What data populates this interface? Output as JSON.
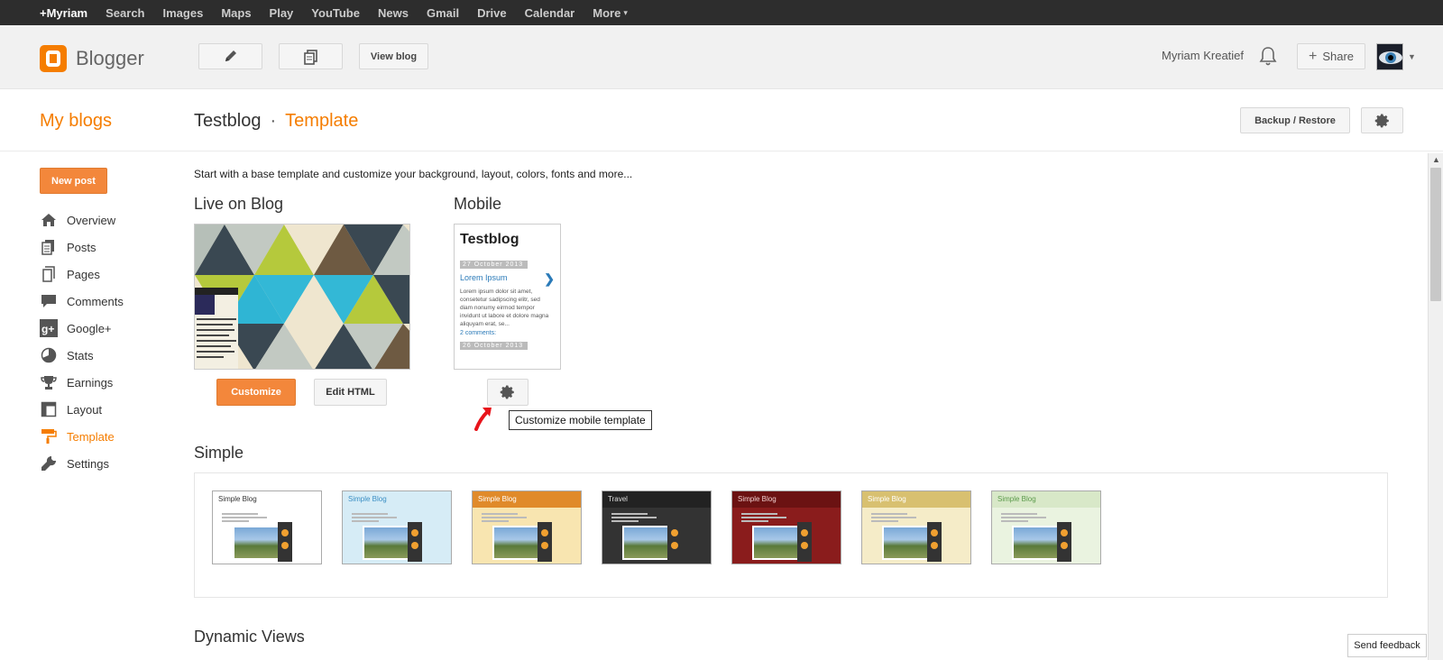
{
  "gbar": {
    "items": [
      "+Myriam",
      "Search",
      "Images",
      "Maps",
      "Play",
      "YouTube",
      "News",
      "Gmail",
      "Drive",
      "Calendar",
      "More"
    ]
  },
  "header": {
    "logo_text": "Blogger",
    "view_blog": "View blog",
    "user_name": "Myriam Kreatief",
    "share": "Share",
    "accent": "#f57d00"
  },
  "titlebar": {
    "my_blogs": "My blogs",
    "blog_name": "Testblog",
    "separator": "·",
    "page": "Template",
    "backup_restore": "Backup / Restore"
  },
  "sidebar": {
    "new_post": "New post",
    "items": [
      {
        "label": "Overview",
        "icon": "home-icon"
      },
      {
        "label": "Posts",
        "icon": "posts-icon"
      },
      {
        "label": "Pages",
        "icon": "pages-icon"
      },
      {
        "label": "Comments",
        "icon": "comment-icon"
      },
      {
        "label": "Google+",
        "icon": "google-plus-icon"
      },
      {
        "label": "Stats",
        "icon": "pie-chart-icon"
      },
      {
        "label": "Earnings",
        "icon": "trophy-icon"
      },
      {
        "label": "Layout",
        "icon": "layout-icon"
      },
      {
        "label": "Template",
        "icon": "paint-roller-icon",
        "active": true
      },
      {
        "label": "Settings",
        "icon": "wrench-icon"
      }
    ]
  },
  "main": {
    "intro": "Start with a base template and customize your background, layout, colors, fonts and more...",
    "live_title": "Live on Blog",
    "mobile_title": "Mobile",
    "mobile_preview": {
      "blog_title": "Testblog",
      "date1": "27 October 2013",
      "post_link": "Lorem Ipsum",
      "body": "Lorem ipsum dolor sit amet, consetetur sadipscing elitr, sed diam nonumy eirmod tempor invidunt ut labore et dolore magna aliquyam erat, se...",
      "comments": "2 comments:",
      "date2": "26 October 2013"
    },
    "customize": "Customize",
    "edit_html": "Edit HTML",
    "tooltip": "Customize mobile template",
    "simple_title": "Simple",
    "simple_thumbs": [
      {
        "title": "Simple Blog",
        "bg": "#ffffff",
        "hdr": "#ffffff",
        "text": "#333333"
      },
      {
        "title": "Simple Blog",
        "bg": "#d6ecf6",
        "hdr": "#d6ecf6",
        "text": "#3b8fc4"
      },
      {
        "title": "Simple Blog",
        "bg": "#f8e5b0",
        "hdr": "#e08a2a",
        "text": "#ffffff"
      },
      {
        "title": "Travel",
        "bg": "#333333",
        "hdr": "#222222",
        "text": "#dddddd"
      },
      {
        "title": "Simple Blog",
        "bg": "#8a1c1c",
        "hdr": "#6b1212",
        "text": "#f0d0d0"
      },
      {
        "title": "Simple Blog",
        "bg": "#f5ecc8",
        "hdr": "#d8c070",
        "text": "#ffffff"
      },
      {
        "title": "Simple Blog",
        "bg": "#eaf3e0",
        "hdr": "#d8e8c8",
        "text": "#5a9a4a"
      }
    ],
    "dynamic_title": "Dynamic Views"
  },
  "feedback": "Send feedback"
}
